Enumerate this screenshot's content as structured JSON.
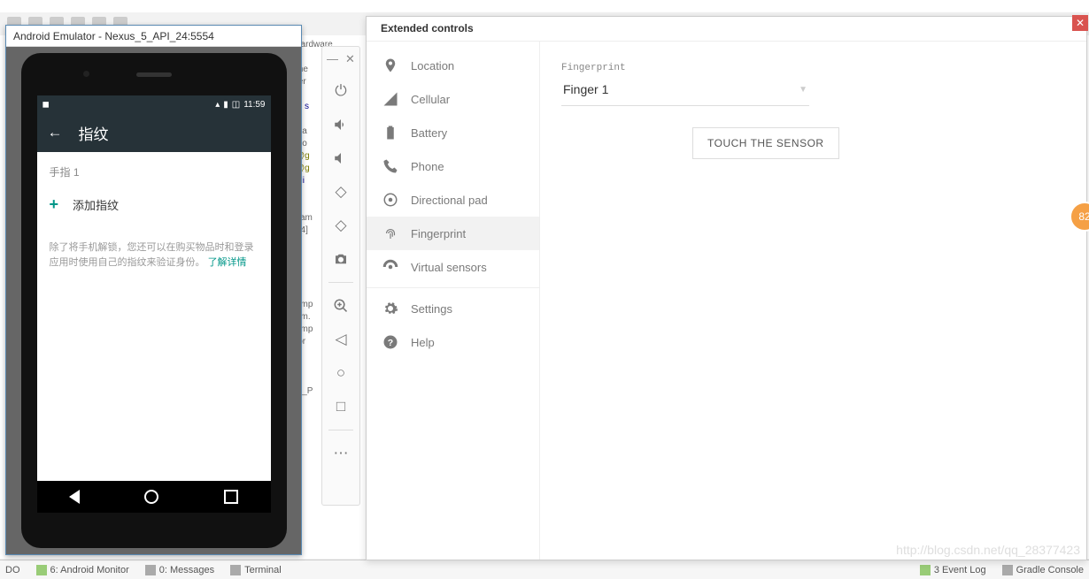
{
  "ide": {
    "bottom": {
      "todo": "DO",
      "monitor": "6: Android Monitor",
      "messages": "0: Messages",
      "terminal": "Terminal",
      "eventlog": "3  Event Log",
      "gradle": "Gradle Console"
    }
  },
  "emulator": {
    "title": "Android Emulator - Nexus_5_API_24:5554",
    "status": {
      "time": "11:59"
    },
    "appbar": {
      "title": "指纹"
    },
    "content": {
      "label": "手指 1",
      "add": "添加指纹",
      "tip": "除了将手机解锁，您还可以在购买物品时和登录应用时使用自己的指纹来验证身份。",
      "link": "了解详情"
    }
  },
  "sidebar_icons": [
    "power",
    "vol-up",
    "vol-down",
    "rotate-left",
    "rotate-right",
    "camera",
    "zoom",
    "back",
    "circle",
    "square",
    "more"
  ],
  "ext": {
    "title": "Extended controls",
    "nav": [
      "Location",
      "Cellular",
      "Battery",
      "Phone",
      "Directional pad",
      "Fingerprint",
      "Virtual sensors",
      "Settings",
      "Help"
    ],
    "active": "Fingerprint",
    "fp": {
      "label": "Fingerprint",
      "selected": "Finger 1",
      "button": "TOUCH THE SENSOR"
    }
  },
  "watermark": "http://blog.csdn.net/qq_28377423",
  "badge": "82"
}
